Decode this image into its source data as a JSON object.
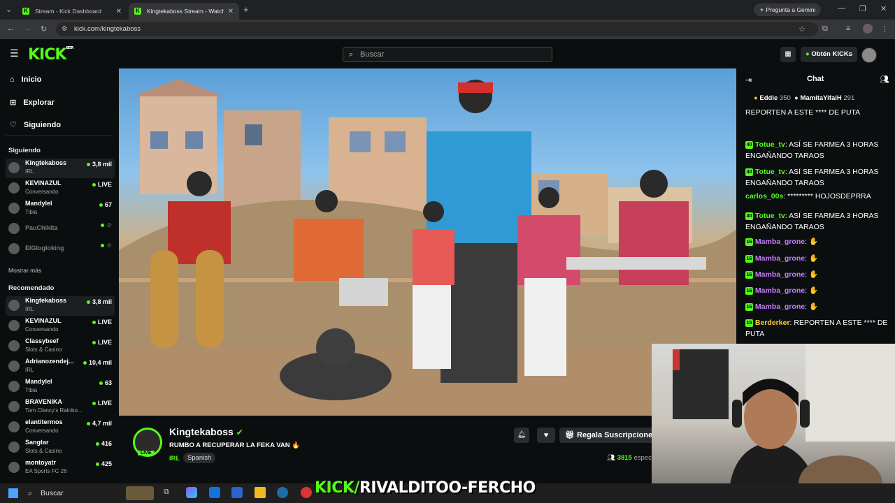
{
  "browser": {
    "tabs": [
      {
        "title": "Stream - Kick Dashboard"
      },
      {
        "title": "Kingtekaboss Stream - Watch L"
      }
    ],
    "gemini_label": "Pregunta a Gemini",
    "url": "kick.com/kingtekaboss"
  },
  "header": {
    "logo": "KICK",
    "logo_beta": "BETA",
    "search_placeholder": "Buscar",
    "kicks_button": "Obtén KICKs"
  },
  "sidebar": {
    "nav": [
      {
        "label": "Inicio",
        "icon": "home-icon"
      },
      {
        "label": "Explorar",
        "icon": "compass-icon"
      },
      {
        "label": "Siguiendo",
        "icon": "heart-icon"
      }
    ],
    "following_title": "Siguiendo",
    "following": [
      {
        "name": "Kingtekaboss",
        "sub": "IRL",
        "viewers": "3,8 mil",
        "live": true,
        "selected": true
      },
      {
        "name": "KEVINAZUL",
        "sub": "Conversando",
        "viewers": "LIVE",
        "live": true
      },
      {
        "name": "Mandylel",
        "sub": "Tibia",
        "viewers": "67",
        "live": true
      },
      {
        "name": "PauChikita",
        "sub": "",
        "viewers": "",
        "live": false
      },
      {
        "name": "ElGlogloking",
        "sub": "",
        "viewers": "",
        "live": false
      }
    ],
    "show_more": "Mostrar más",
    "recommended_title": "Recomendado",
    "recommended": [
      {
        "name": "Kingtekaboss",
        "sub": "IRL",
        "viewers": "3,8 mil",
        "selected": true
      },
      {
        "name": "KEVINAZUL",
        "sub": "Conversando",
        "viewers": "LIVE"
      },
      {
        "name": "Classybeef",
        "sub": "Slots & Casino",
        "viewers": "LIVE"
      },
      {
        "name": "Adrianozendej...",
        "sub": "IRL",
        "viewers": "10,4 mil"
      },
      {
        "name": "Mandylel",
        "sub": "Tibia",
        "viewers": "63"
      },
      {
        "name": "BRAVENIKA",
        "sub": "Tom Clancy's Rainbo...",
        "viewers": "LIVE"
      },
      {
        "name": "elantitermos",
        "sub": "Conversando",
        "viewers": "4,7 mil"
      },
      {
        "name": "Sangtar",
        "sub": "Slots & Casino",
        "viewers": "416"
      },
      {
        "name": "montoyatr",
        "sub": "EA Sports FC 26",
        "viewers": "425"
      }
    ]
  },
  "stream": {
    "streamer": "Kingtekaboss",
    "title": "RUMBO A RECUPERAR LA FEKA VAN 🔥",
    "category": "IRL",
    "tag": "Spanish",
    "live_badge": "LIVE",
    "sub_button": "Regala Suscripciones",
    "viewers": "3815",
    "viewers_suffix": "espec"
  },
  "chat": {
    "title": "Chat",
    "top": [
      {
        "name": "Eddie",
        "value": "350"
      },
      {
        "name": "MamitaYifaiH",
        "value": "291"
      }
    ],
    "messages": [
      {
        "user": "",
        "badge": "",
        "text": "REPORTEN A ESTE **** DE PUTA",
        "color": "#ffffff"
      },
      {
        "user": "Totue_tv",
        "badge": "40",
        "text": "ASÍ SE FARMEA 3 HORAS ENGAÑANDO TARAOS",
        "color": "#53fc18"
      },
      {
        "user": "Totue_tv",
        "badge": "40",
        "text": "ASÍ SE FARMEA 3 HORAS ENGAÑANDO TARAOS",
        "color": "#53fc18"
      },
      {
        "user": "carlos_00s",
        "badge": "",
        "text": "********* HOJOSDEPRRA",
        "color": "#53fc18"
      },
      {
        "user": "Totue_tv",
        "badge": "40",
        "text": "ASÍ SE FARMEA 3 HORAS ENGAÑANDO TARAOS",
        "color": "#53fc18"
      },
      {
        "user": "Mamba_grone",
        "badge": "16",
        "text": "",
        "color": "#c77dff"
      },
      {
        "user": "Mamba_grone",
        "badge": "16",
        "text": "",
        "color": "#c77dff"
      },
      {
        "user": "Mamba_grone",
        "badge": "16",
        "text": "",
        "color": "#c77dff"
      },
      {
        "user": "Mamba_grone",
        "badge": "16",
        "text": "",
        "color": "#c77dff"
      },
      {
        "user": "Mamba_grone",
        "badge": "16",
        "text": "",
        "color": "#c77dff"
      },
      {
        "user": "Berderker",
        "badge": "15",
        "text": "REPORTEN A ESTE **** DE PUTA",
        "color": "#ffd23f"
      }
    ]
  },
  "overlay": {
    "banner_prefix": "KICK/",
    "banner_name": "RIVALDITOO-FERCHO"
  },
  "taskbar": {
    "search": "Buscar"
  },
  "colors": {
    "accent": "#53fc18",
    "bg": "#0b0e0f"
  }
}
